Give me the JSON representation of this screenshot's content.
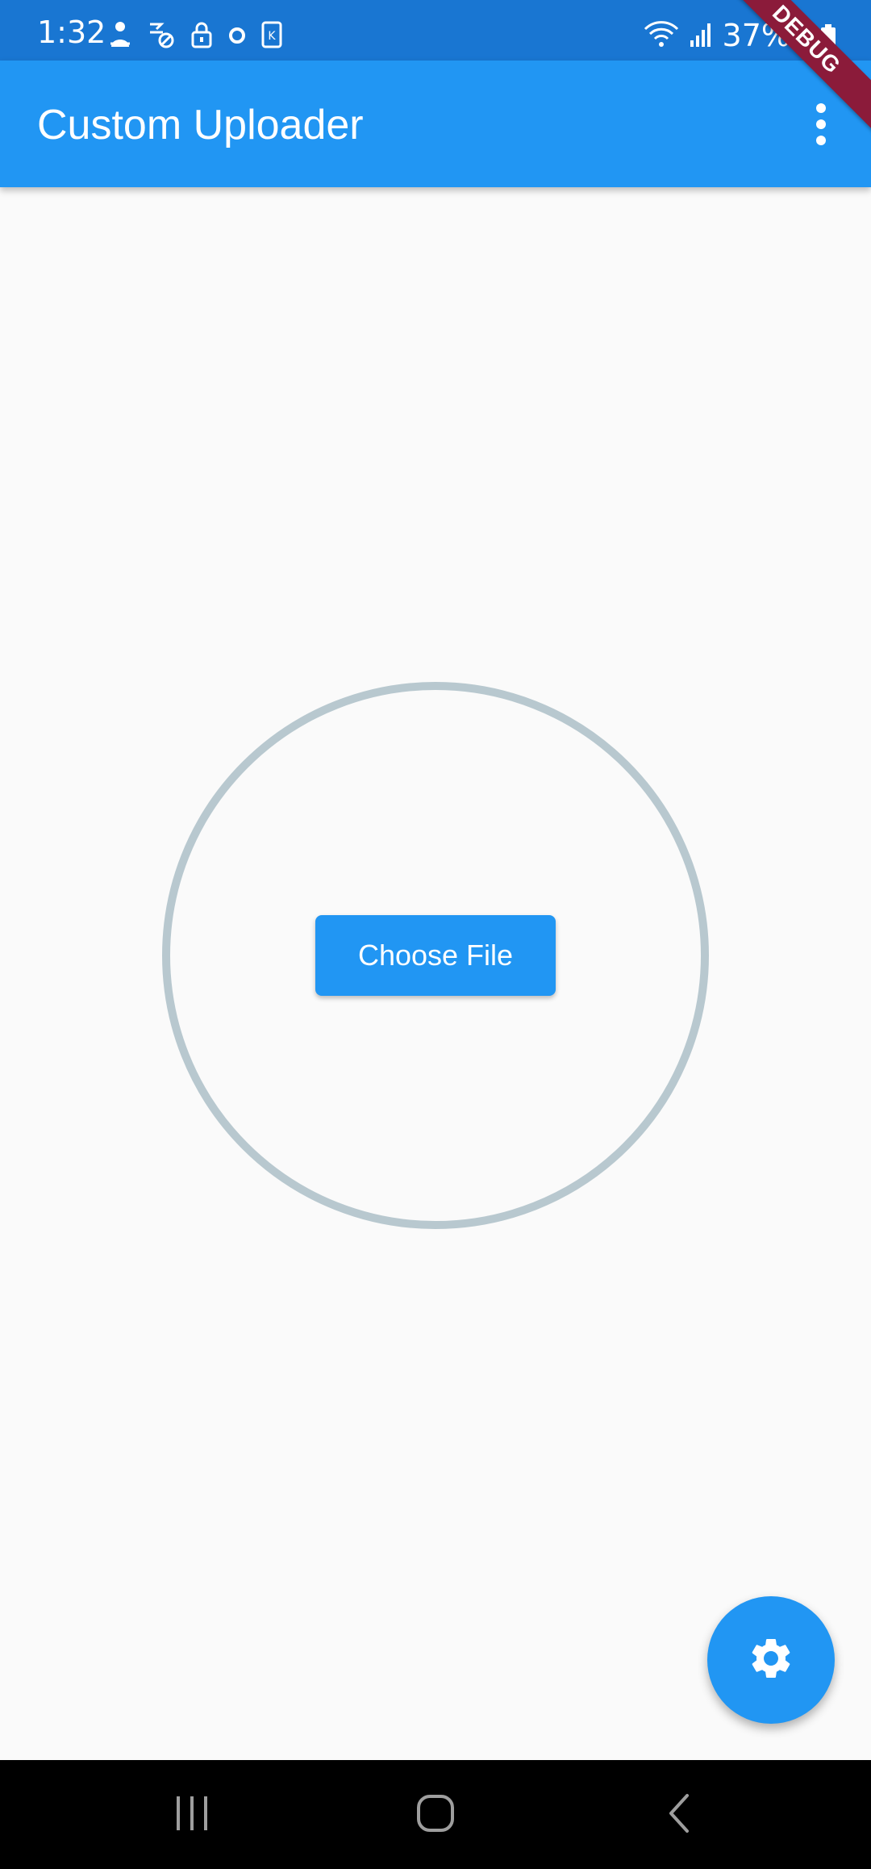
{
  "status_bar": {
    "time": "1:32",
    "battery_percent": "37%",
    "left_icons": [
      "person-icon",
      "sync-off-icon",
      "lock-icon",
      "circle-icon",
      "k-app-icon"
    ],
    "right_icons": [
      "wifi-icon",
      "signal-icon",
      "battery-icon"
    ]
  },
  "app_bar": {
    "title": "Custom Uploader",
    "menu_icon": "more-vert-icon"
  },
  "debug_banner": {
    "label": "DEBUG"
  },
  "main": {
    "choose_file_label": "Choose File"
  },
  "fab": {
    "icon": "settings-icon"
  },
  "nav_bar": {
    "buttons": [
      "recent-apps-icon",
      "home-icon",
      "back-icon"
    ]
  },
  "colors": {
    "primary": "#2196f3",
    "status_bar": "#1976d2",
    "ring": "#b8c8cf",
    "background": "#fafafa",
    "debug": "#8b1b3a"
  }
}
